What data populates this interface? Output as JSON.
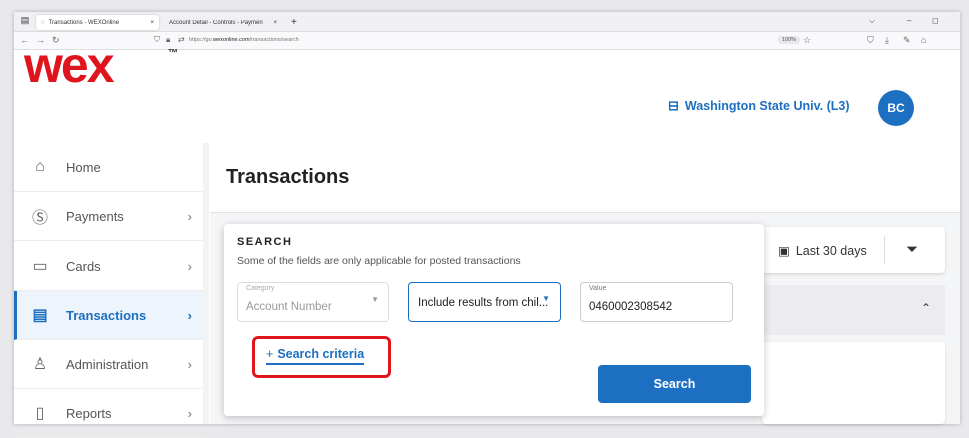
{
  "browser": {
    "tabs": [
      {
        "label": "Transactions - WEXOnline"
      },
      {
        "label": "Account Detail - Controls - Paymen"
      }
    ],
    "new_tab": "+",
    "tab_close": "×",
    "url_prefix": "https://go.",
    "url_domain": "wexonline.com",
    "url_path": "/transactions/search",
    "zoom": "100%"
  },
  "header": {
    "logo_text": "wex",
    "logo_mark": "™",
    "org_name": "Washington State Univ. (L3)",
    "avatar_initials": "BC"
  },
  "sidebar": {
    "items": [
      {
        "label": "Home",
        "icon": "home-icon"
      },
      {
        "label": "Payments",
        "icon": "dollar-icon"
      },
      {
        "label": "Cards",
        "icon": "card-icon"
      },
      {
        "label": "Transactions",
        "icon": "receipt-icon",
        "active": true
      },
      {
        "label": "Administration",
        "icon": "user-icon"
      },
      {
        "label": "Reports",
        "icon": "report-icon"
      }
    ]
  },
  "main": {
    "title": "Transactions",
    "date_range": "Last 30 days"
  },
  "search": {
    "heading": "SEARCH",
    "subtitle": "Some of the fields are only applicable for posted transactions",
    "category_label": "Category",
    "category_value": "Account Number",
    "scope_value": "Include results from chil...",
    "value_label": "Value",
    "value_value": "0460002308542",
    "criteria_plus": "+",
    "criteria_label": "Search criteria",
    "button_label": "Search"
  },
  "colors": {
    "brand_red": "#e0141c",
    "accent_blue": "#1d6fc2"
  }
}
